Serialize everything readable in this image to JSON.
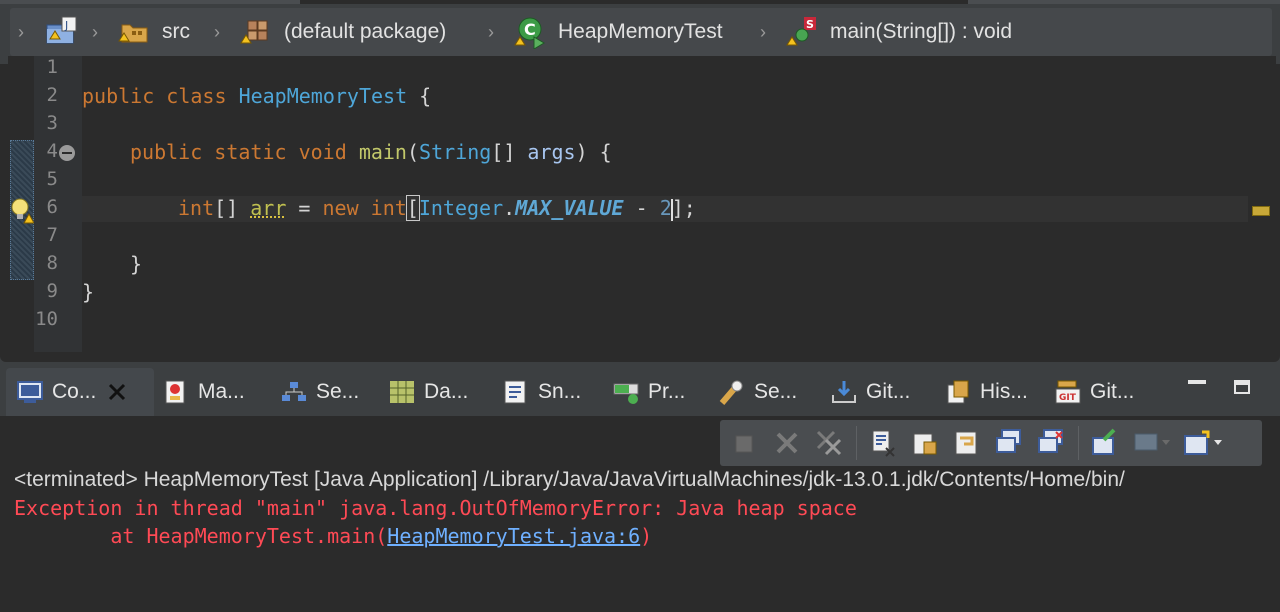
{
  "breadcrumb": {
    "items": [
      {
        "label": "",
        "icon": "java-project-icon"
      },
      {
        "label": "src",
        "icon": "source-folder-icon"
      },
      {
        "label": "(default package)",
        "icon": "package-icon"
      },
      {
        "label": "HeapMemoryTest",
        "icon": "java-class-icon"
      },
      {
        "label": "main(String[]) : void",
        "icon": "static-method-icon"
      }
    ]
  },
  "editor": {
    "line_numbers": [
      "1",
      "2",
      "3",
      "4",
      "5",
      "6",
      "7",
      "8",
      "9",
      "10"
    ],
    "lines": {
      "l2": {
        "kw1": "public",
        "kw2": "class",
        "cls": "HeapMemoryTest",
        "rest": " {"
      },
      "l4": {
        "kw1": "public",
        "kw2": "static",
        "kw3": "void",
        "meth": "main",
        "open": "(",
        "cls": "String",
        "arr": "[] ",
        "param": "args",
        "close": ") {"
      },
      "l6": {
        "kw1": "int",
        "br": "[] ",
        "var": "arr",
        "eq": " = ",
        "kw2": "new",
        "sp": " ",
        "kw3": "int",
        "ob": "[",
        "cls": "Integer",
        "dot": ".",
        "const": "MAX_VALUE",
        "minus": " - ",
        "num": "2",
        "end": "];"
      },
      "l8": {
        "text": "}"
      },
      "l9": {
        "text": "}"
      }
    }
  },
  "console": {
    "tabs": [
      {
        "label": "Co...",
        "icon": "console-icon",
        "active": true
      },
      {
        "label": "Ma...",
        "icon": "markers-icon"
      },
      {
        "label": "Se...",
        "icon": "servers-icon"
      },
      {
        "label": "Da...",
        "icon": "data-source-icon"
      },
      {
        "label": "Sn...",
        "icon": "snippets-icon"
      },
      {
        "label": "Pr...",
        "icon": "progress-icon"
      },
      {
        "label": "Se...",
        "icon": "search-icon"
      },
      {
        "label": "Git...",
        "icon": "git-staging-icon"
      },
      {
        "label": "His...",
        "icon": "history-icon"
      },
      {
        "label": "Git...",
        "icon": "git-repositories-icon"
      }
    ],
    "terminated_text": "<terminated> HeapMemoryTest [Java Application] /Library/Java/JavaVirtualMachines/jdk-13.0.1.jdk/Contents/Home/bin/",
    "error_line1": "Exception in thread \"main\" java.lang.OutOfMemoryError: Java heap space",
    "error_line2_prefix": "\tat HeapMemoryTest.main(",
    "error_link": "HeapMemoryTest.java:6",
    "error_line2_suffix": ")"
  },
  "colors": {
    "keyword": "#cc7832",
    "class": "#4ea6d8",
    "error": "#ff4a55",
    "link": "#6fb0ff"
  }
}
